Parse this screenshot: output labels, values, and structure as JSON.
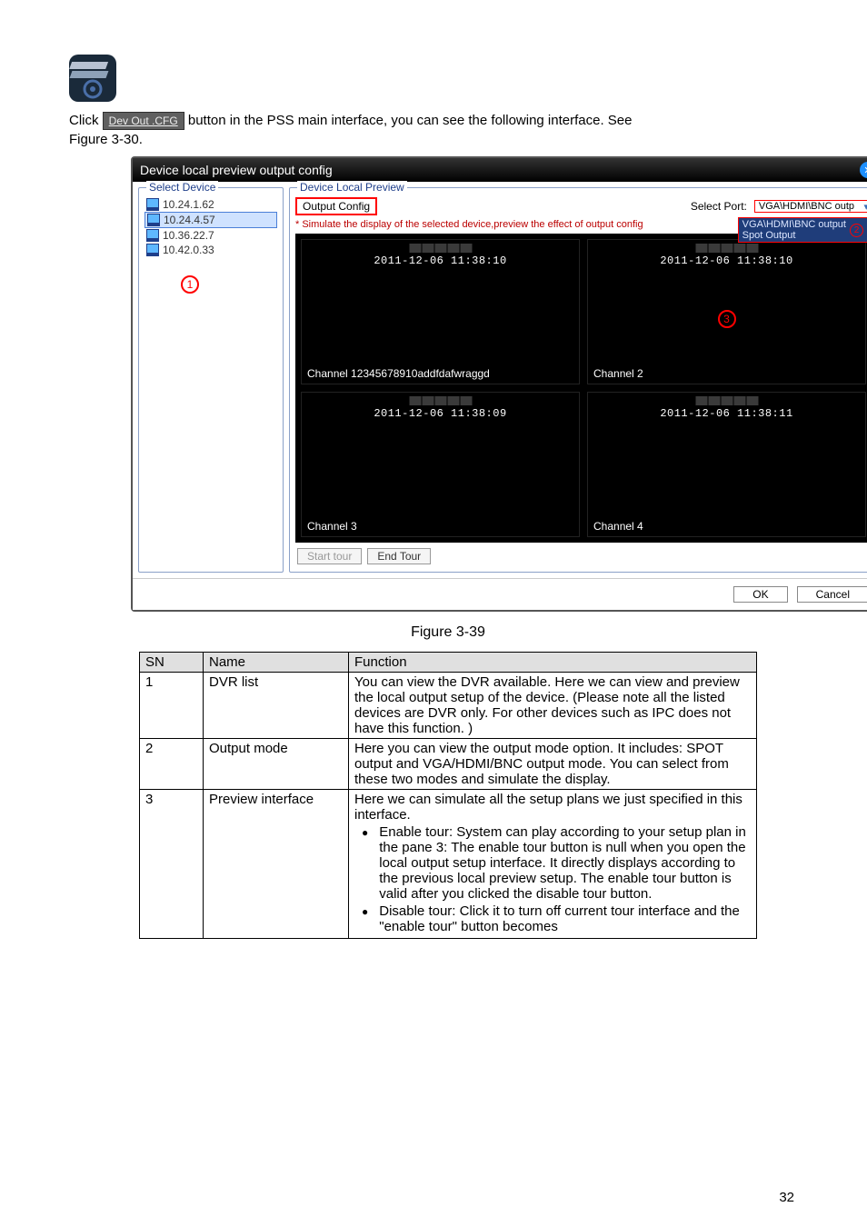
{
  "intro": {
    "click_prefix": "Click ",
    "dev_out_btn": "Dev Out .CFG",
    "click_suffix": " button in the PSS main interface, you can see the following interface. See",
    "fig_ref": "Figure 3-30."
  },
  "dialog": {
    "title": "Device local preview output config",
    "select_device_legend": "Select Device",
    "devices": [
      "10.24.1.62",
      "10.24.4.57",
      "10.36.22.7",
      "10.42.0.33"
    ],
    "circle1": "1",
    "local_preview_legend": "Device Local Preview",
    "output_config_btn": "Output Config",
    "select_port_label": "Select Port:",
    "port_selected": "VGA\\HDMI\\BNC outp",
    "port_popup_line1": "VGA\\HDMI\\BNC output",
    "port_popup_line2": "Spot Output",
    "circle2": "2",
    "sim_note": "* Simulate the display of the selected device,preview the effect of  output config",
    "cells": [
      {
        "ts": "2011-12-06 11:38:10",
        "label": "Channel 12345678910addfdafwraggd"
      },
      {
        "ts": "2011-12-06 11:38:10",
        "label": "Channel 2",
        "circle3": "3"
      },
      {
        "ts": "2011-12-06 11:38:09",
        "label": "Channel 3"
      },
      {
        "ts": "2011-12-06 11:38:11",
        "label": "Channel 4"
      }
    ],
    "start_tour": "Start tour",
    "end_tour": "End Tour",
    "ok": "OK",
    "cancel": "Cancel"
  },
  "figure_caption": "Figure 3-39",
  "table": {
    "headers": {
      "sn": "SN",
      "name": "Name",
      "function": "Function"
    },
    "rows": [
      {
        "sn": "1",
        "name": "DVR list",
        "func": "You can view the DVR available. Here we can view and preview the local output setup of the device. (Please note all the listed devices are DVR only. For other devices such as IPC does not have this function. )"
      },
      {
        "sn": "2",
        "name": "Output mode",
        "func": "Here you can view the output mode option. It includes: SPOT output and VGA/HDMI/BNC output mode. You can select from these two modes and simulate the display."
      },
      {
        "sn": "3",
        "name": "Preview interface",
        "func_intro": "Here we can simulate all the setup plans we just specified in this interface.",
        "bullets": [
          "Enable tour: System can play according to your setup plan in the pane 3: The enable tour button is null when you open the local output setup interface. It directly displays according to the previous local preview setup. The enable tour button is valid after you clicked the disable tour button.",
          "Disable tour: Click it to turn off current tour interface and the \"enable tour\" button becomes"
        ]
      }
    ]
  },
  "page_number": "32"
}
